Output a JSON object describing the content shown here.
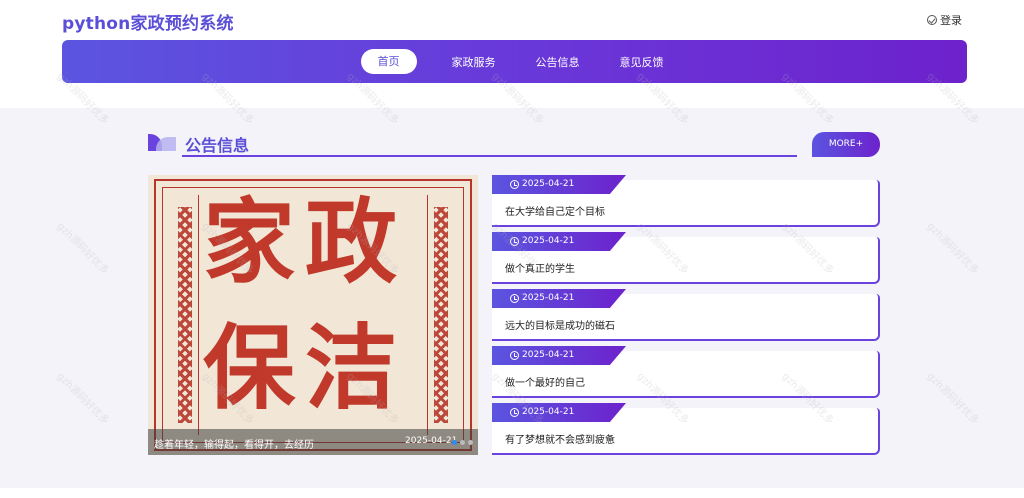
{
  "header": {
    "logo": "python家政预约系统",
    "login_label": "登录"
  },
  "nav": {
    "items": [
      {
        "label": "首页",
        "active": true
      },
      {
        "label": "家政服务",
        "active": false
      },
      {
        "label": "公告信息",
        "active": false
      },
      {
        "label": "意见反馈",
        "active": false
      }
    ]
  },
  "section": {
    "title": "公告信息",
    "more_label": "MORE+"
  },
  "carousel": {
    "poster_line1": "家政",
    "poster_line2": "保洁",
    "caption": "趁着年轻，输得起，看得开，去经历",
    "date": "2025-04-21",
    "slide_count": 3,
    "active_slide": 1
  },
  "news": [
    {
      "date": "2025-04-21",
      "title": "在大学给自己定个目标"
    },
    {
      "date": "2025-04-21",
      "title": "做个真正的学生"
    },
    {
      "date": "2025-04-21",
      "title": "远大的目标是成功的磁石"
    },
    {
      "date": "2025-04-21",
      "title": "做一个最好的自己"
    },
    {
      "date": "2025-04-21",
      "title": "有了梦想就不会感到疲惫"
    }
  ],
  "watermark": "gzh源码好优多",
  "colors": {
    "brand": "#5b4fd8",
    "gradient_start": "#5b55e0",
    "gradient_end": "#6d22cc",
    "poster_red": "#c0392b",
    "content_bg": "#f3f3f9"
  }
}
